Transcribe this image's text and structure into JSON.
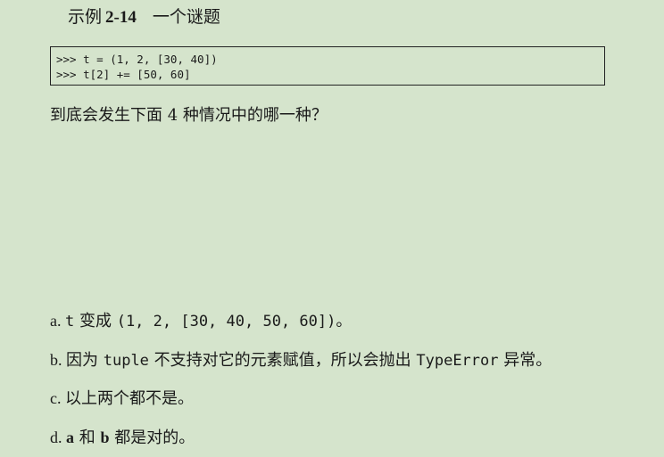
{
  "caption": {
    "prefix": "示例",
    "number": "2-14",
    "title": "一个谜题"
  },
  "code": {
    "line1": ">>> t = (1, 2, [30, 40])",
    "line2": ">>> t[2] += [50, 60]"
  },
  "question": "到底会发生下面 4 种情况中的哪一种？",
  "options": {
    "a": {
      "marker": "a. ",
      "code1": "t",
      "text1": " 变成 ",
      "code2": "(1, 2, [30, 40, 50, 60])",
      "text2": "。"
    },
    "b": {
      "marker": "b. ",
      "text1": "因为 ",
      "code1": "tuple",
      "text2": " 不支持对它的元素赋值，所以会抛出 ",
      "code2": "TypeError",
      "text3": " 异常。"
    },
    "c": {
      "marker": "c. ",
      "text": "以上两个都不是。"
    },
    "d": {
      "marker": "d. ",
      "bold1": "a",
      "text1": " 和 ",
      "bold2": "b",
      "text2": " 都是对的。"
    }
  }
}
